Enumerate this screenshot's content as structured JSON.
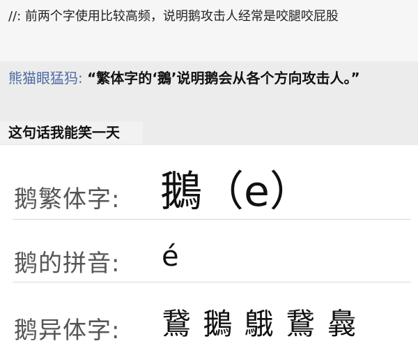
{
  "top_comment": {
    "text": "//: 前两个字使用比较高频，说明鹅攻击人经常是咬腿咬屁股"
  },
  "reply": {
    "author": "熊猫眼猛犸:",
    "quote": "“繁体字的‘鵝’说明鹅会从各个方向攻击人。”",
    "remark": "这句话我能笑一天"
  },
  "dictionary": {
    "traditional": {
      "label": "鹅繁体字:",
      "value": "鵝（e）"
    },
    "pinyin": {
      "label": "鹅的拼音:",
      "value": "é"
    },
    "variants": {
      "label": "鹅异体字:",
      "value": "鵞 鵝 䳘 鵞 䳗"
    }
  }
}
